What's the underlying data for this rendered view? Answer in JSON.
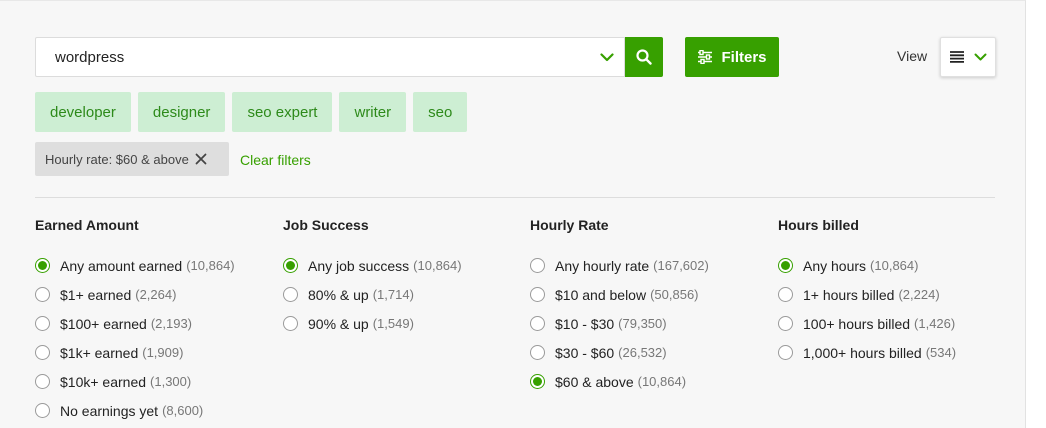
{
  "search": {
    "value": "wordpress"
  },
  "filters_button": {
    "label": "Filters"
  },
  "view": {
    "label": "View"
  },
  "tags": [
    "developer",
    "designer",
    "seo expert",
    "writer",
    "seo"
  ],
  "active_filter": {
    "label": "Hourly rate: $60 & above"
  },
  "clear_filters": "Clear filters",
  "columns": [
    {
      "title": "Earned Amount",
      "options": [
        {
          "label": "Any amount earned",
          "count": "(10,864)",
          "checked": true
        },
        {
          "label": "$1+ earned",
          "count": "(2,264)",
          "checked": false
        },
        {
          "label": "$100+ earned",
          "count": "(2,193)",
          "checked": false
        },
        {
          "label": "$1k+ earned",
          "count": "(1,909)",
          "checked": false
        },
        {
          "label": "$10k+ earned",
          "count": "(1,300)",
          "checked": false
        },
        {
          "label": "No earnings yet",
          "count": "(8,600)",
          "checked": false
        }
      ]
    },
    {
      "title": "Job Success",
      "options": [
        {
          "label": "Any job success",
          "count": "(10,864)",
          "checked": true
        },
        {
          "label": "80% & up",
          "count": "(1,714)",
          "checked": false
        },
        {
          "label": "90% & up",
          "count": "(1,549)",
          "checked": false
        }
      ]
    },
    {
      "title": "Hourly Rate",
      "options": [
        {
          "label": "Any hourly rate",
          "count": "(167,602)",
          "checked": false
        },
        {
          "label": "$10 and below",
          "count": "(50,856)",
          "checked": false
        },
        {
          "label": "$10 - $30",
          "count": "(79,350)",
          "checked": false
        },
        {
          "label": "$30 - $60",
          "count": "(26,532)",
          "checked": false
        },
        {
          "label": "$60 & above",
          "count": "(10,864)",
          "checked": true
        }
      ]
    },
    {
      "title": "Hours billed",
      "options": [
        {
          "label": "Any hours",
          "count": "(10,864)",
          "checked": true
        },
        {
          "label": "1+ hours billed",
          "count": "(2,224)",
          "checked": false
        },
        {
          "label": "100+ hours billed",
          "count": "(1,426)",
          "checked": false
        },
        {
          "label": "1,000+ hours billed",
          "count": "(534)",
          "checked": false
        }
      ]
    }
  ],
  "icons": {
    "search": "search-icon",
    "dropdown": "chevron-down-icon",
    "filters": "sliders-icon",
    "list_view": "list-view-icon",
    "close": "close-icon"
  },
  "colors": {
    "accent": "#37a000",
    "tag_bg": "#cdeed3",
    "tag_text": "#2d8a1a",
    "chip_bg": "#dedede"
  }
}
